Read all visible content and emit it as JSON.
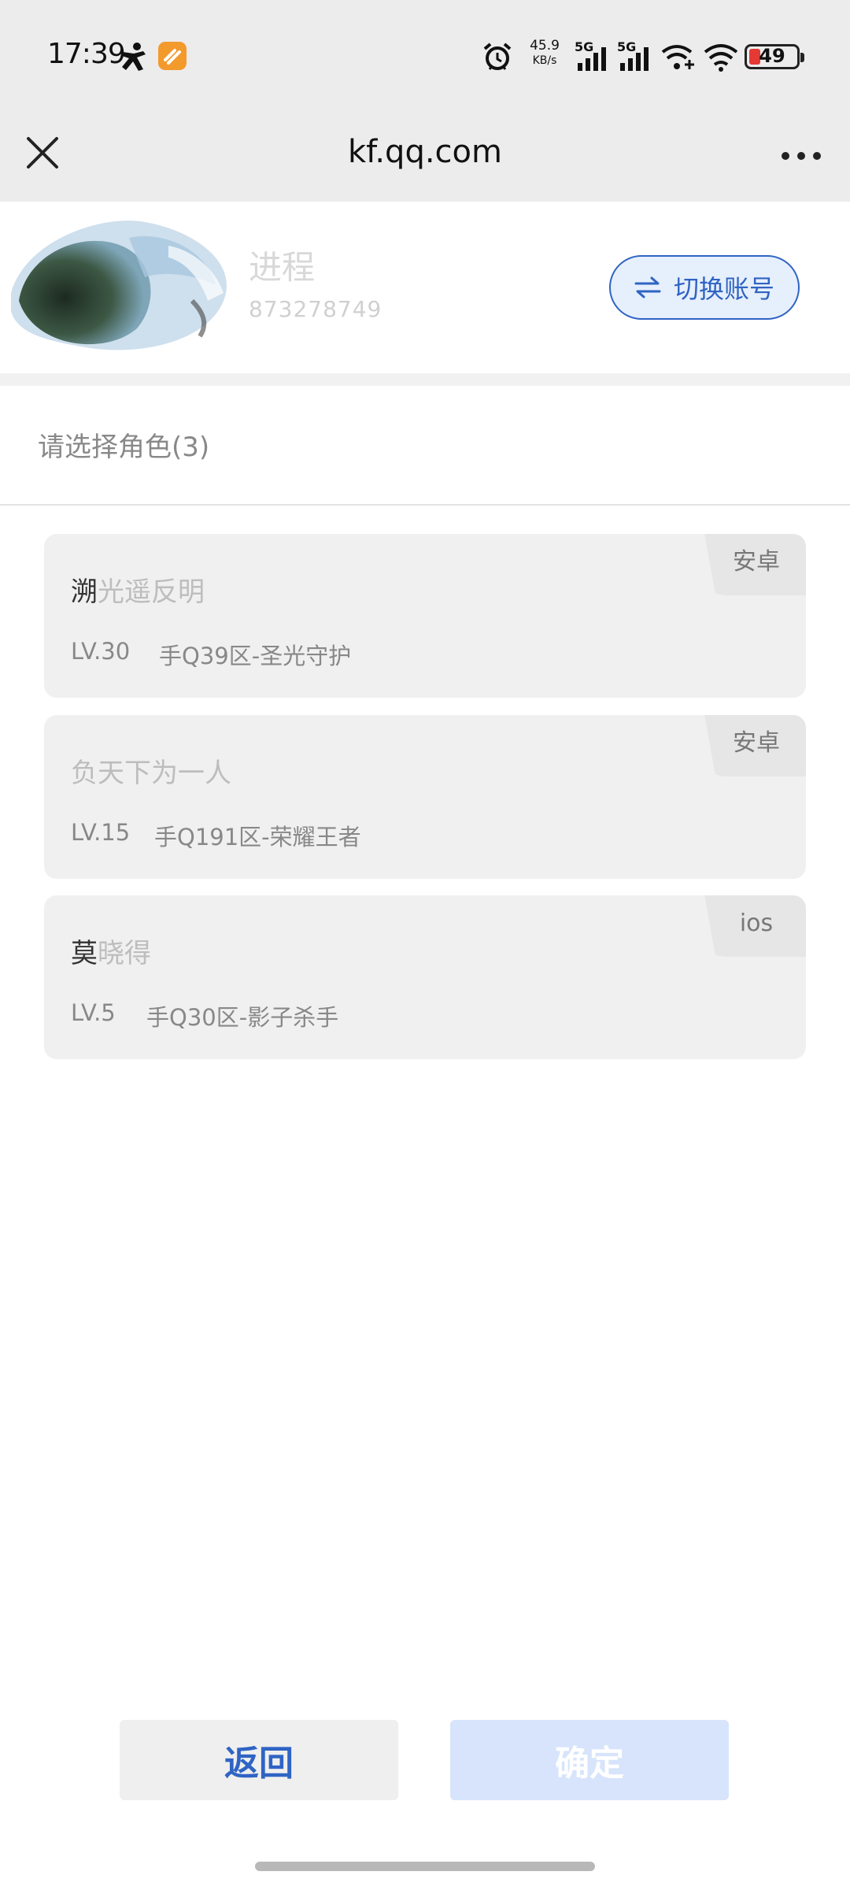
{
  "status_bar": {
    "time": "17:39",
    "net_speed_value": "45.9",
    "net_speed_unit": "KB/s",
    "signal1_label": "5G",
    "signal2_label": "5G",
    "battery": "49",
    "battery_color": "#e53935",
    "icons": [
      "person-icon",
      "app-badge-icon",
      "alarm-icon",
      "signal-icon",
      "signal-icon",
      "wifi-plus-icon",
      "wifi-icon",
      "battery-icon"
    ]
  },
  "title_bar": {
    "url": "kf.qq.com",
    "close_icon": "close-icon",
    "more_icon": "more-icon"
  },
  "account": {
    "name": "进程",
    "id": "873278749",
    "switch_label": "切换账号",
    "switch_icon": "swap-arrows-icon",
    "accent_color": "#2f64c4"
  },
  "roles_section": {
    "heading": "请选择角色(3)",
    "roles": [
      {
        "name_first": "溯",
        "name_rest": "光遥反明",
        "level": "LV.30",
        "server": "手Q39区-圣光守护",
        "platform": "安卓"
      },
      {
        "name_first": "",
        "name_rest": "负天下为一人",
        "level": "LV.15",
        "server": "手Q191区-荣耀王者",
        "platform": "安卓"
      },
      {
        "name_first": "莫",
        "name_rest": "晓得",
        "level": "LV.5",
        "server": "手Q30区-影子杀手",
        "platform": "ios"
      }
    ]
  },
  "footer": {
    "back_label": "返回",
    "confirm_label": "确定"
  }
}
